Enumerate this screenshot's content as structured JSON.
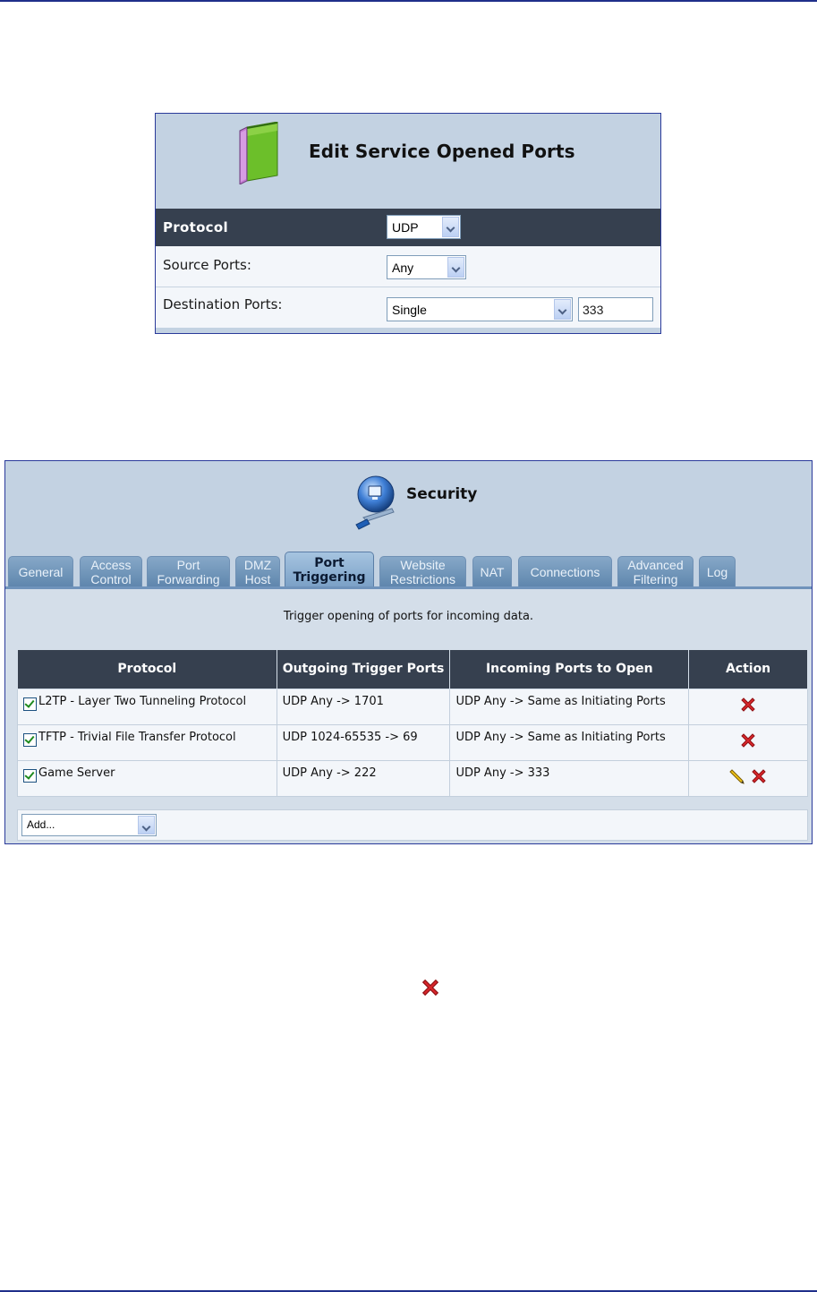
{
  "edit_service": {
    "title": "Edit Service Opened Ports",
    "header_label": "Protocol",
    "protocol_value": "UDP",
    "rows": [
      {
        "label": "Source Ports:",
        "value": "Any"
      },
      {
        "label": "Destination Ports:",
        "value": "Single",
        "port_value": "333"
      }
    ]
  },
  "security": {
    "title": "Security",
    "tabs": [
      {
        "label": "General"
      },
      {
        "label": "Access Control"
      },
      {
        "label": "Port Forwarding"
      },
      {
        "label": "DMZ Host"
      },
      {
        "label": "Port Triggering",
        "active": true
      },
      {
        "label": "Website Restrictions"
      },
      {
        "label": "NAT"
      },
      {
        "label": "Connections"
      },
      {
        "label": "Advanced Filtering"
      },
      {
        "label": "Log"
      }
    ],
    "description": "Trigger opening of ports for incoming data.",
    "columns": [
      "Protocol",
      "Outgoing Trigger Ports",
      "Incoming Ports to Open",
      "Action"
    ],
    "rows": [
      {
        "protocol": "L2TP - Layer Two Tunneling Protocol",
        "outgoing": "UDP Any -> 1701",
        "incoming": "UDP Any -> Same as Initiating Ports",
        "checked": true,
        "editable": false
      },
      {
        "protocol": "TFTP - Trivial File Transfer Protocol",
        "outgoing": "UDP 1024-65535 -> 69",
        "incoming": "UDP Any -> Same as Initiating Ports",
        "checked": true,
        "editable": false
      },
      {
        "protocol": "Game Server",
        "outgoing": "UDP Any -> 222",
        "incoming": "UDP Any -> 333",
        "checked": true,
        "editable": true
      }
    ],
    "add_select": "Add..."
  },
  "icons": {
    "panel1": "book-icon",
    "panel2": "security-globe-icon",
    "delete": "delete-x-icon",
    "edit": "pencil-icon",
    "standalone": "delete-x-icon"
  },
  "colors": {
    "panel_bg": "#c3d2e2",
    "header_dark": "#36404f",
    "row_bg": "#f3f6fa",
    "border_blue": "#2a3a9a",
    "delete_red": "#d9262b"
  }
}
